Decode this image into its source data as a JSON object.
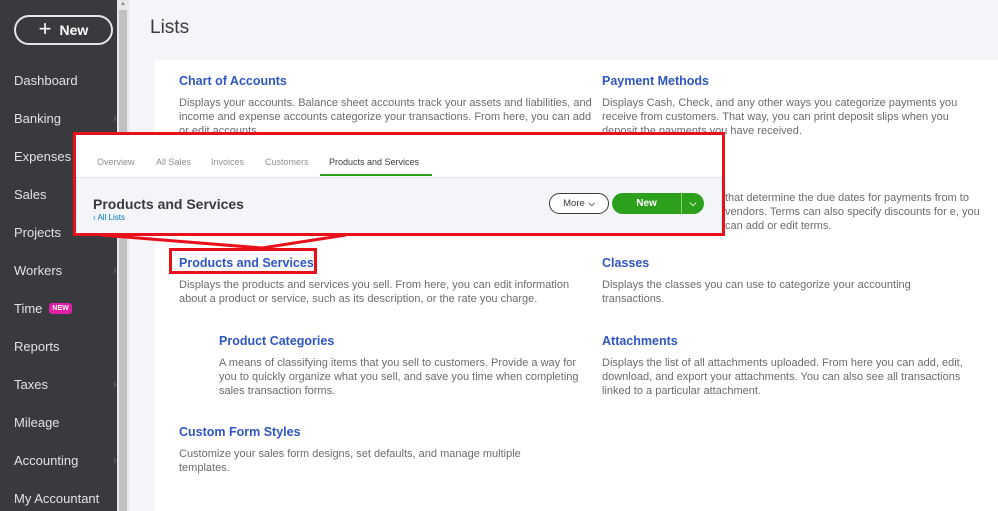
{
  "sidebar": {
    "new_label": "New",
    "items": [
      {
        "label": "Dashboard",
        "chevron": false
      },
      {
        "label": "Banking",
        "chevron": true
      },
      {
        "label": "Expenses",
        "chevron": true
      },
      {
        "label": "Sales",
        "chevron": true
      },
      {
        "label": "Projects",
        "chevron": false
      },
      {
        "label": "Workers",
        "chevron": true
      },
      {
        "label": "Time",
        "chevron": false,
        "badge": "NEW"
      },
      {
        "label": "Reports",
        "chevron": false
      },
      {
        "label": "Taxes",
        "chevron": true
      },
      {
        "label": "Mileage",
        "chevron": false
      },
      {
        "label": "Accounting",
        "chevron": true
      },
      {
        "label": "My Accountant",
        "chevron": false
      }
    ]
  },
  "page": {
    "title": "Lists",
    "items": {
      "chart_of_accounts": {
        "title": "Chart of Accounts",
        "desc": "Displays your accounts. Balance sheet accounts track your assets and liabilities, and income and expense accounts categorize your transactions. From here, you can add or edit accounts."
      },
      "payment_methods": {
        "title": "Payment Methods",
        "desc": "Displays Cash, Check, and any other ways you categorize payments you receive from customers. That way, you can print deposit slips when you deposit the payments you have received."
      },
      "terms": {
        "desc": "that determine the due dates for payments from to vendors. Terms can also specify discounts for e, you can add or edit terms."
      },
      "products_services": {
        "title": "Products and Services",
        "desc": "Displays the products and services you sell. From here, you can edit information about a product or service, such as its description, or the rate you charge."
      },
      "classes": {
        "title": "Classes",
        "desc": "Displays the classes you can use to categorize your accounting transactions."
      },
      "product_categories": {
        "title": "Product Categories",
        "desc": "A means of classifying items that you sell to customers. Provide a way for you to quickly organize what you sell, and save you time when completing sales transaction forms."
      },
      "attachments": {
        "title": "Attachments",
        "desc": "Displays the list of all attachments uploaded. From here you can add, edit, download, and export your attachments. You can also see all transactions linked to a particular attachment."
      },
      "custom_form_styles": {
        "title": "Custom Form Styles",
        "desc": "Customize your sales form designs, set defaults, and manage multiple templates."
      }
    }
  },
  "callout": {
    "tabs": [
      "Overview",
      "All Sales",
      "Invoices",
      "Customers",
      "Products and Services"
    ],
    "active_tab": "Products and Services",
    "title": "Products and Services",
    "back_link": "All Lists",
    "more_label": "More",
    "new_label": "New"
  },
  "colors": {
    "sidebar_bg": "#393a3d",
    "link_blue": "#2f56c3",
    "accent_green": "#2ca01c",
    "highlight_red": "#e8101a",
    "badge_pink": "#e01fa4"
  }
}
